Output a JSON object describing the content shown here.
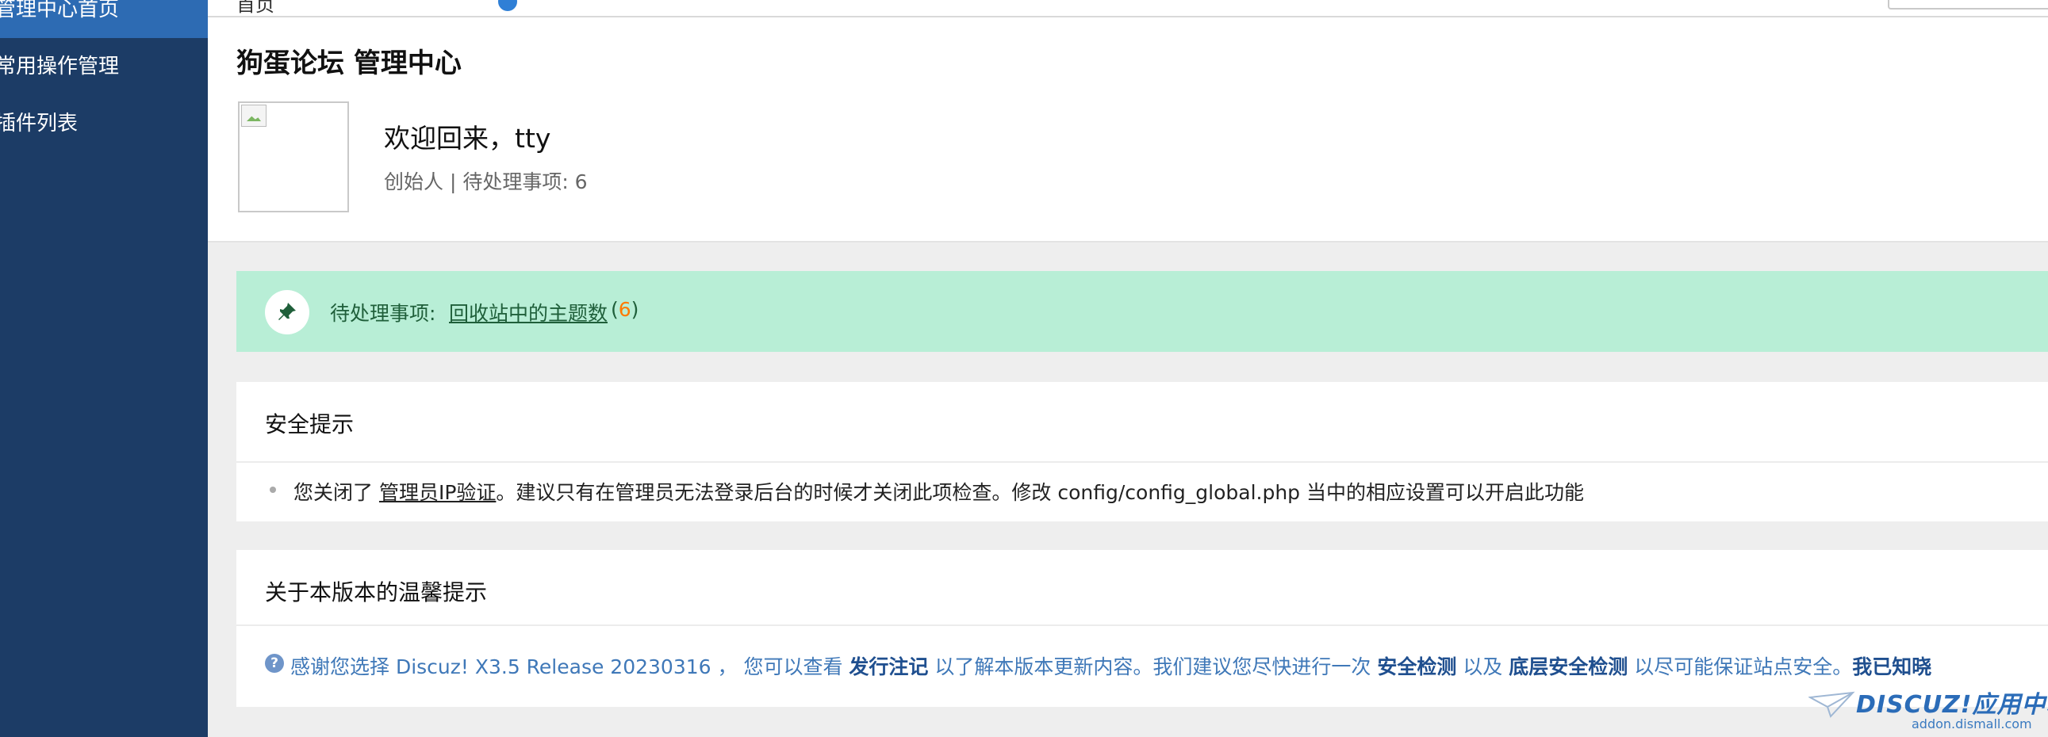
{
  "sidebar": {
    "items": [
      {
        "label": "管理中心首页",
        "active": true
      },
      {
        "label": "常用操作管理",
        "active": false
      },
      {
        "label": "插件列表",
        "active": false
      }
    ]
  },
  "topbar": {
    "crumb": "首页"
  },
  "header": {
    "title": "狗蛋论坛 管理中心",
    "welcome": "欢迎回来，tty",
    "role_line": "创始人 | 待处理事项: 6"
  },
  "pending": {
    "label": "待处理事项:",
    "link": "回收站中的主题数",
    "count_open": "(",
    "count": "6",
    "count_close": ")",
    "icon": "pin-icon"
  },
  "security": {
    "title": "安全提示",
    "text_before": "您关闭了 ",
    "link": "管理员IP验证",
    "text_after": "。建议只有在管理员无法登录后台的时候才关闭此项检查。修改 config/config_global.php 当中的相应设置可以开启此功能"
  },
  "tips": {
    "title": "关于本版本的温馨提示",
    "icon": "info-icon",
    "part1": "感谢您选择 Discuz! X3.5 Release 20230316 ， 您可以查看 ",
    "link1": "发行注记",
    "part2": " 以了解本版本更新内容。我们建议您尽快进行一次 ",
    "link2": "安全检测",
    "part3": " 以及 ",
    "link3": "底层安全检测",
    "part4": " 以尽可能保证站点安全。",
    "link4": "我已知晓"
  },
  "watermark": {
    "brand": "DISCUZ!应用中心",
    "site": "addon.dismall.com"
  },
  "colors": {
    "sidebar_bg": "#1c3c66",
    "sidebar_active": "#2d6bb3",
    "pending_bg": "#b8eed6",
    "pending_count": "#ff7a00",
    "link_blue": "#3f78b8"
  }
}
